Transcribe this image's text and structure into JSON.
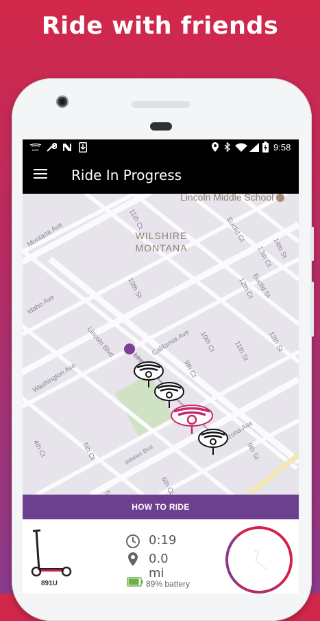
{
  "headline": "Ride with friends",
  "status_bar": {
    "time": "9:58",
    "left_icons": [
      "bird-logo-icon",
      "wrench-icon",
      "nfc-icon",
      "download-icon"
    ],
    "right_icons": [
      "location-icon",
      "bluetooth-icon",
      "wifi-icon",
      "signal-icon",
      "battery-charging-icon"
    ]
  },
  "app_bar": {
    "title": "Ride In Progress",
    "menu_icon": "hamburger-menu-icon"
  },
  "map": {
    "neighborhood": "WILSHIRE\nMONTANA",
    "poi": "Lincoln Middle School",
    "streets": {
      "eleventh_ct": "11th Ct",
      "eleventh_st": "11th St",
      "tenth_st": "10th St",
      "tenth_ct": "10th Ct",
      "twelfth_st": "12th St",
      "twelfth_ct": "12th Ct",
      "thirteenth_ct": "13th Ct",
      "fourteenth_st": "14th St",
      "ninth_ct": "9th Ct",
      "ninth_st": "9th St",
      "sixth_ct": "6th Ct",
      "fifth_ct": "5th Ct",
      "fourth_ct": "4th Ct",
      "fifth_st": "5th",
      "euclid_ct": "Euclid Ct",
      "euclid_st": "Euclid St",
      "montana_ave": "Montana Ave",
      "idaho_ave": "Idaho Ave",
      "washington_ave": "Washington Ave",
      "california_ave": "California Ave",
      "arizona_ave": "Arizona Ave",
      "wilshire_blvd": "Wilshire Blvd",
      "lincoln_blvd": "Lincoln Blvd",
      "lincoln_short": "Linco"
    },
    "accent": "#d3234d",
    "scooter_marker_count": 4
  },
  "how_to_ride": "HOW TO RIDE",
  "ride": {
    "scooter_id": "891U",
    "duration": "0:19",
    "distance": "0.0 mi",
    "battery": "89% battery",
    "battery_level": 0.89
  }
}
